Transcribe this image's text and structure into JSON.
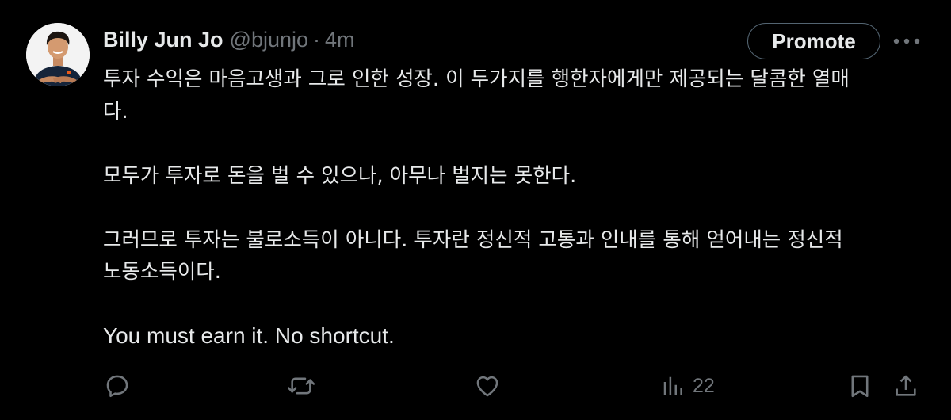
{
  "tweet": {
    "author": {
      "display_name": "Billy Jun Jo",
      "handle": "@bjunjo",
      "separator": "·",
      "time": "4m"
    },
    "promote_label": "Promote",
    "more_icon": "ellipsis-icon",
    "paragraphs": [
      [
        "투자 수익은 마음고생과 그로 인한 성장. 이 두가지를 행한자에게만 제공되는 달콤한 열매",
        "다."
      ],
      [
        "모두가 투자로 돈을 벌 수 있으나, 아무나 벌지는 못한다."
      ],
      [
        "그러므로 투자는 불로소득이 아니다. 투자란 정신적 고통과 인내를 통해 얻어내는 정신적",
        "노동소득이다."
      ],
      [
        "You must earn it. No shortcut."
      ]
    ],
    "actions": {
      "reply_icon": "reply-icon",
      "repost_icon": "repost-icon",
      "like_icon": "heart-icon",
      "views_icon": "views-icon",
      "views_count": "22",
      "bookmark_icon": "bookmark-icon",
      "share_icon": "share-icon"
    },
    "colors": {
      "background": "#000000",
      "primary_text": "#e7e9ea",
      "secondary_text": "#71767b",
      "button_border": "#536471"
    }
  }
}
